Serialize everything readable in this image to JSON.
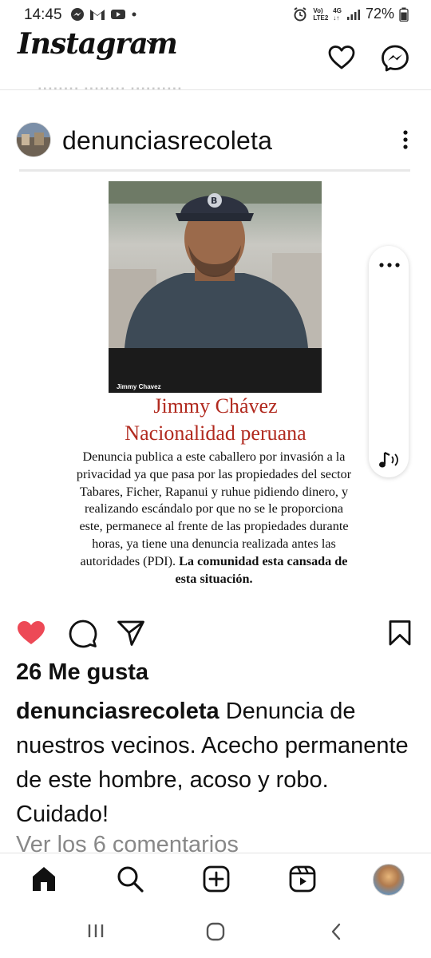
{
  "status_bar": {
    "time": "14:45",
    "network_line1": "Vo)",
    "network_line2": "LTE2",
    "network_type": "4G",
    "battery": "72%"
  },
  "header": {
    "app_name": "Instagram"
  },
  "post": {
    "username": "denunciasrecoleta",
    "photo_caption": "Jimmy Chavez",
    "flyer": {
      "name": "Jimmy Chávez",
      "nationality": "Nacionalidad peruana",
      "body": "Denuncia publica a este caballero por invasión a la privacidad ya que pasa por las propiedades del sector Tabares, Ficher, Rapanui y ruhue pidiendo dinero, y realizando escándalo por que no se le proporciona este, permanece al frente de las propiedades durante horas, ya tiene una denuncia realizada antes las autoridades (PDI).",
      "body_bold": "La comunidad esta cansada de esta situación."
    },
    "likes": "26 Me gusta",
    "caption_user": "denunciasrecoleta",
    "caption_text": "Denuncia de nuestros vecinos. Acecho permanente de este hombre, acoso y robo. Cuidado!",
    "view_comments": "Ver los 6 comentarios"
  },
  "colors": {
    "like_red": "#ed4956",
    "flyer_red": "#b12a1f"
  },
  "icons": {
    "header": [
      "heart-icon",
      "messenger-icon"
    ],
    "actions": [
      "heart-filled-icon",
      "comment-icon",
      "share-icon",
      "bookmark-icon"
    ],
    "bottom_nav": [
      "home-icon",
      "search-icon",
      "add-post-icon",
      "reels-icon",
      "profile-avatar"
    ]
  }
}
